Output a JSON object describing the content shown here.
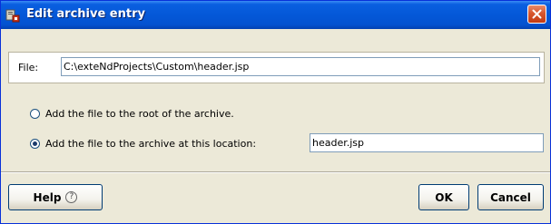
{
  "window": {
    "title": "Edit archive entry",
    "close_icon": "close-icon",
    "app_icon": "archive-entry-icon"
  },
  "file": {
    "label": "File:",
    "value": "C:\\exteNdProjects\\Custom\\header.jsp"
  },
  "options": {
    "root_label": "Add the file to the root of the archive.",
    "root_selected": false,
    "location_label": "Add the file to the archive at this location:",
    "location_selected": true,
    "location_value": "header.jsp"
  },
  "buttons": {
    "help_label": "Help",
    "help_icon": "help-icon",
    "ok_label": "OK",
    "cancel_label": "Cancel"
  },
  "colors": {
    "titlebar": "#0458d8",
    "window_bg": "#ece9d8",
    "close_button": "#d8582f"
  }
}
